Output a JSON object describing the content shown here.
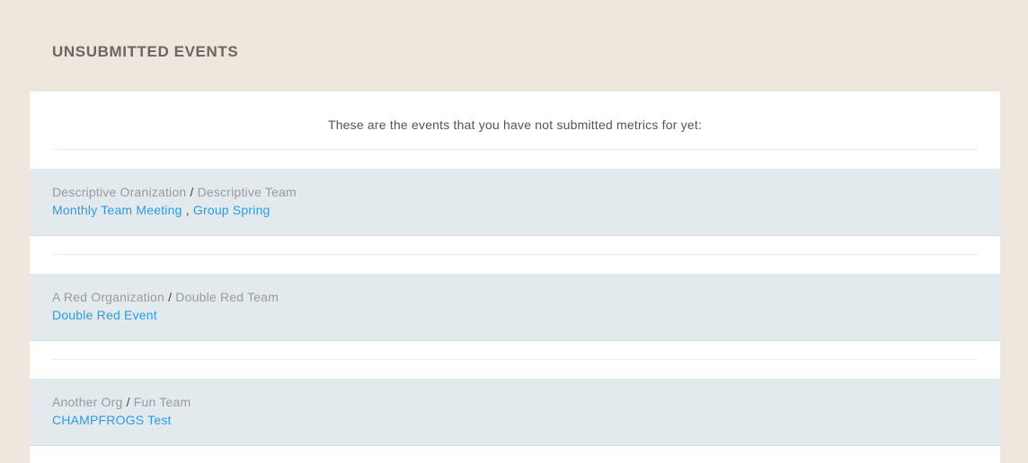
{
  "header": {
    "title": "UNSUBMITTED EVENTS"
  },
  "intro": {
    "text": "These are the events that you have not submitted metrics for yet:"
  },
  "groups": [
    {
      "organization": "Descriptive Oranization",
      "separator": "/",
      "team": "Descriptive Team",
      "events": [
        "Monthly Team Meeting",
        "Group Spring"
      ],
      "event_separator": ","
    },
    {
      "organization": "A Red Organization",
      "separator": "/",
      "team": "Double Red Team",
      "events": [
        "Double Red Event"
      ]
    },
    {
      "organization": "Another Org",
      "separator": "/",
      "team": "Fun Team",
      "events": [
        "CHAMPFROGS Test"
      ]
    }
  ],
  "colors": {
    "page_background": "#ede6dc",
    "panel_background": "#ffffff",
    "group_background": "#e3eaee",
    "link": "#2b9be6",
    "muted_text": "#9a9a9a"
  }
}
